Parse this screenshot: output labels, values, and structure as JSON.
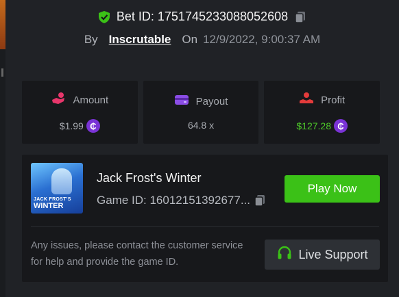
{
  "bet": {
    "label": "Bet ID: 1751745233088052608",
    "by_label": "By",
    "user": "Inscrutable",
    "on_label": "On",
    "date": "12/9/2022, 9:00:37 AM"
  },
  "stats": [
    {
      "label": "Amount",
      "value": "$1.99",
      "icon": "amount-icon",
      "has_coin": true
    },
    {
      "label": "Payout",
      "value": "64.8 x",
      "icon": "wallet-icon",
      "has_coin": false
    },
    {
      "label": "Profit",
      "value": "$127.28",
      "icon": "profit-icon",
      "has_coin": true
    }
  ],
  "coin_symbol": "₵",
  "game": {
    "title": "Jack Frost's Winter",
    "id_label": "Game ID: 16012151392677...",
    "thumb_line1": "JACK FROST'S",
    "thumb_line2": "WINTER",
    "play_label": "Play Now"
  },
  "support": {
    "help_text": "Any issues, please contact the customer service for help and provide the game ID.",
    "button_label": "Live Support"
  },
  "colors": {
    "background": "#202226",
    "panel": "#17181b",
    "accent_green": "#3bc117",
    "profit_green": "#4ecb2a",
    "coin_purple": "#7a33d6"
  }
}
